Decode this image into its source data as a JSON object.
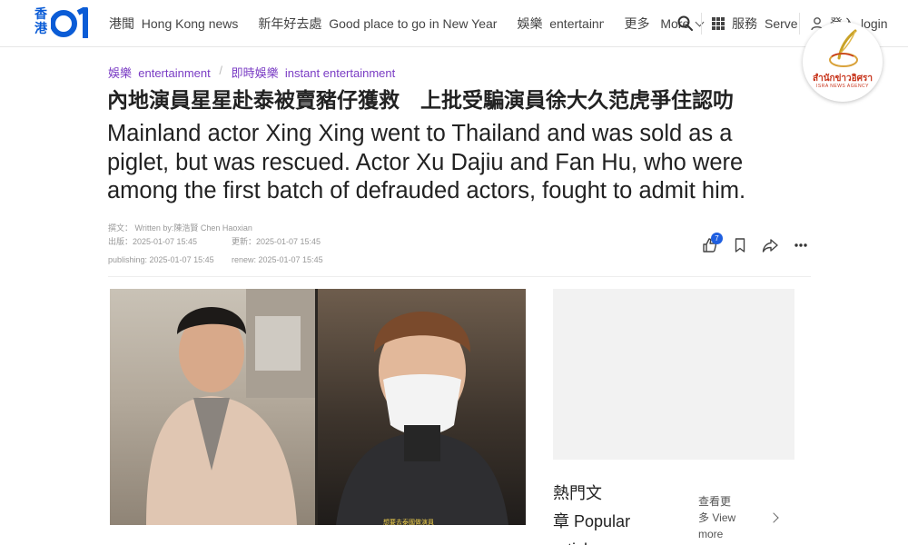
{
  "header": {
    "logo_text": "香港",
    "logo_number": "01",
    "nav": [
      {
        "zh": "港聞",
        "en": "Hong Kong news"
      },
      {
        "zh": "新年好去處",
        "en": "Good place to go in New Year"
      },
      {
        "zh": "娛樂",
        "en": "entertainment"
      },
      {
        "zh": "更多",
        "en": "More"
      }
    ],
    "services_zh": "服務",
    "services_en": "Serve",
    "login_zh": "登入",
    "login_en": "login"
  },
  "watermark": {
    "name": "สำนักข่าวอิศรา",
    "sub": "ISRA NEWS AGENCY"
  },
  "breadcrumb": {
    "section_zh": "娛樂",
    "section_en": "entertainment",
    "sub_zh": "即時娛樂",
    "sub_en": "instant entertainment"
  },
  "article": {
    "title_zh": "內地演員星星赴泰被賣豬仔獲救　上批受騙演員徐大久范虎爭住認叻",
    "title_en": "Mainland actor Xing Xing went to Thailand and was sold as a piglet, but was rescued. Actor Xu Dajiu and Fan Hu, who were among the first batch of defrauded actors, fought to admit him.",
    "meta": {
      "author": "撰文： Written by:陳浩賢  Chen Haoxian",
      "published_zh": "出版：2025-01-07 15:45",
      "updated_zh": "更新：2025-01-07 15:45",
      "published_en": "publishing: 2025-01-07 15:45",
      "updated_en": "renew: 2025-01-07 15:45"
    },
    "like_count": "7",
    "photo_caption": "想要去泰國做演員"
  },
  "sidebar": {
    "popular_zh": "熱門文章",
    "popular_en": "Popular articles",
    "view_more_zh": "查看更多",
    "view_more_en": "View more"
  },
  "colors": {
    "brand_blue": "#0b5cd6",
    "breadcrumb_purple": "#7a3cc4",
    "badge_blue": "#1f5fe0"
  }
}
